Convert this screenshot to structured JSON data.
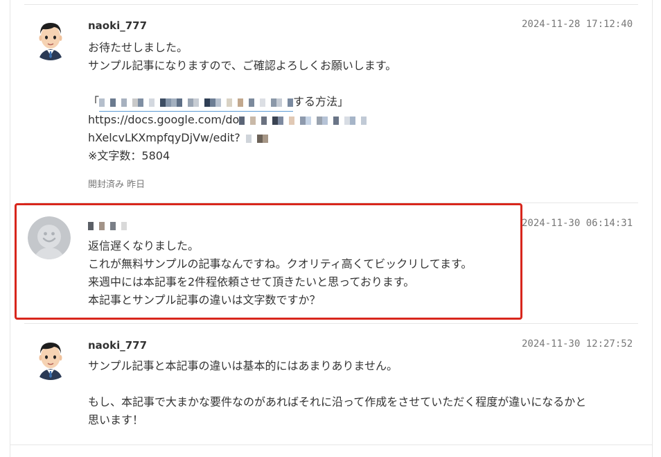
{
  "messages": [
    {
      "author": "naoki_777",
      "timestamp": "2024-11-28 17:12:40",
      "lines": [
        "お待たせしました。",
        "サンプル記事になりますので、ご確認よろしくお願いします。",
        "",
        "「",
        "https://docs.google.com/do",
        "hXelcvLKXmpfqyDjVw/edit?",
        "※文字数：5804"
      ],
      "title_suffix": "する方法」",
      "read_status": "開封済み 昨日"
    },
    {
      "author": "",
      "timestamp": "2024-11-30 06:14:31",
      "lines": [
        "返信遅くなりました。",
        "これが無料サンプルの記事なんですね。クオリティ高くてビックリしてます。",
        "来週中には本記事を2件程依頼させて頂きたいと思っております。",
        "本記事とサンプル記事の違いは文字数ですか？"
      ]
    },
    {
      "author": "naoki_777",
      "timestamp": "2024-11-30 12:27:52",
      "lines": [
        "サンプル記事と本記事の違いは基本的にはあまりありません。",
        "",
        "もし、本記事で大まかな要件なのがあればそれに沿って作成をさせていただく程度が違いになるかと",
        "思います！"
      ]
    }
  ],
  "colors": {
    "highlight_border": "#d8261c",
    "separator": "#e6e6e6",
    "timestamp": "#777777",
    "text": "#333333"
  },
  "icons": {
    "author_avatar": "cartoon-man-avatar-icon",
    "client_avatar": "default-user-avatar-icon"
  }
}
